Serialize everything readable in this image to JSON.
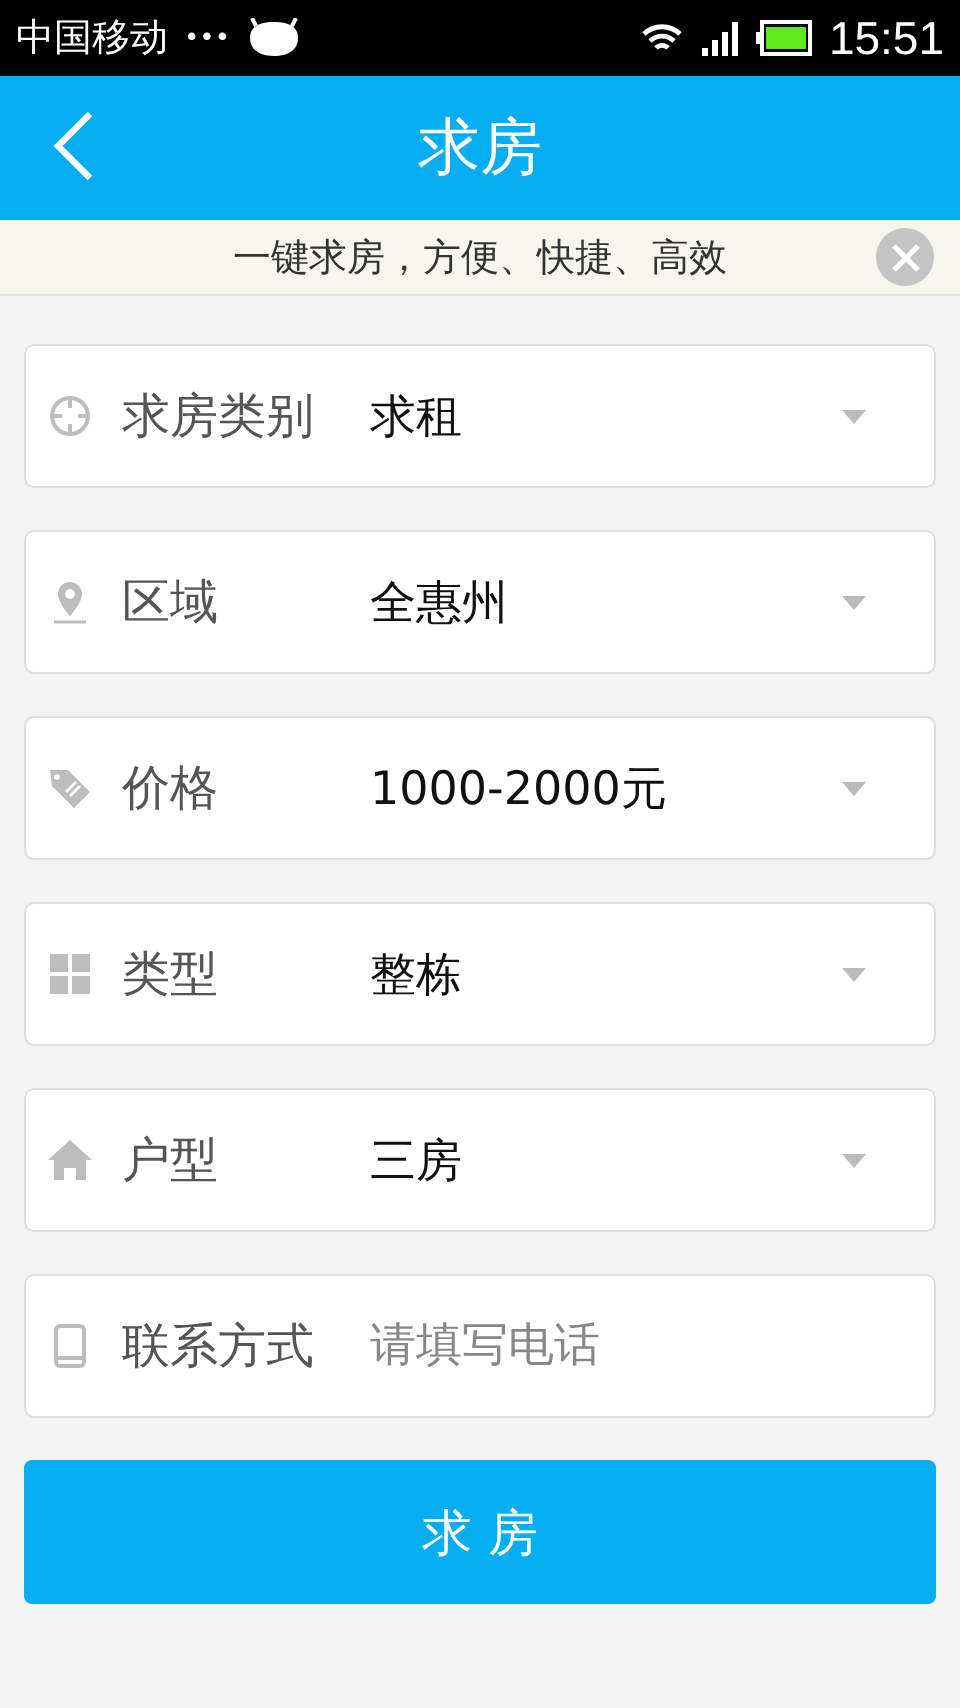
{
  "status_bar": {
    "carrier": "中国移动",
    "dots": "•••",
    "time": "15:51"
  },
  "header": {
    "title": "求房"
  },
  "notice": {
    "text": "一键求房，方便、快捷、高效"
  },
  "fields": [
    {
      "kind": "select",
      "label": "求房类别",
      "value": "求租"
    },
    {
      "kind": "select",
      "label": "区域",
      "value": "全惠州"
    },
    {
      "kind": "select",
      "label": "价格",
      "value": "1000-2000元"
    },
    {
      "kind": "select",
      "label": "类型",
      "value": "整栋"
    },
    {
      "kind": "select",
      "label": "户型",
      "value": "三房"
    },
    {
      "kind": "input",
      "label": "联系方式",
      "placeholder": "请填写电话"
    }
  ],
  "submit": {
    "label": "求 房"
  }
}
